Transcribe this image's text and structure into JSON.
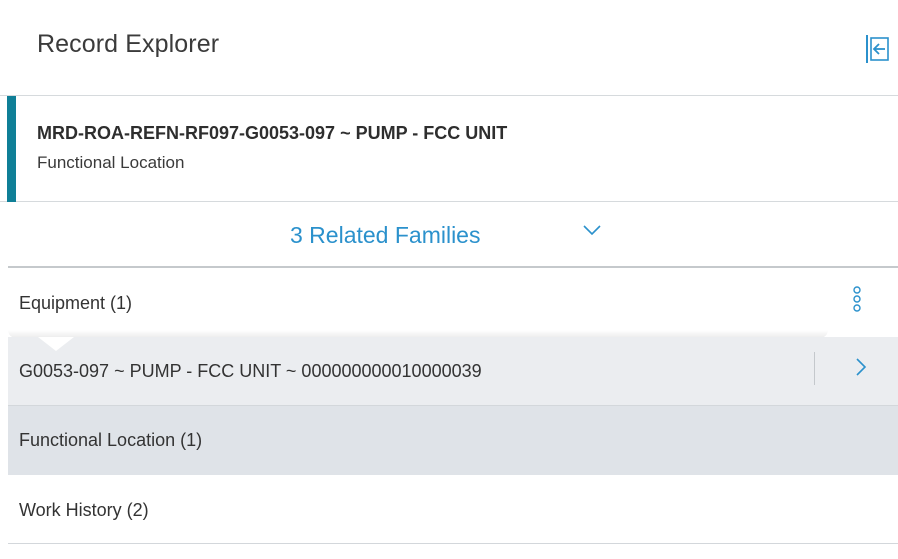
{
  "header": {
    "title": "Record Explorer",
    "collapse_icon": "collapse-left-icon"
  },
  "selected_record": {
    "name": "MRD-ROA-REFN-RF097-G0053-097 ~ PUMP - FCC UNIT",
    "family": "Functional Location",
    "accent_color": "#0f7f97"
  },
  "related": {
    "label": "3 Related Families",
    "toggle_icon": "chevron-down-icon",
    "link_color": "#2b91cc"
  },
  "families": [
    {
      "label": "Equipment (1)",
      "menu_icon": "kebab-menu-icon",
      "records": [
        {
          "label": "G0053-097 ~ PUMP - FCC UNIT ~ 000000000010000039",
          "open_icon": "chevron-right-icon"
        }
      ]
    },
    {
      "label": "Functional Location (1)"
    },
    {
      "label": "Work History (2)"
    }
  ]
}
